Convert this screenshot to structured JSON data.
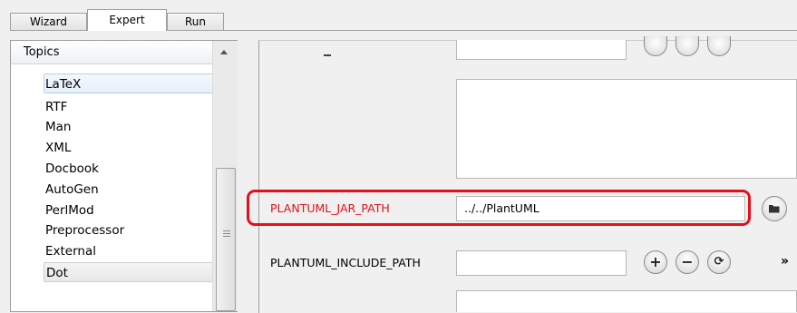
{
  "tabs": [
    {
      "label": "Wizard",
      "active": false
    },
    {
      "label": "Expert",
      "active": true
    },
    {
      "label": "Run",
      "active": false
    }
  ],
  "topics": {
    "header": "Topics",
    "items": [
      "LaTeX",
      "RTF",
      "Man",
      "XML",
      "Docbook",
      "AutoGen",
      "PerlMod",
      "Preprocessor",
      "External",
      "Dot"
    ],
    "selected": "LaTeX"
  },
  "settings": {
    "jar_path": {
      "label": "PLANTUML_JAR_PATH",
      "value": "../../PlantUML",
      "label_color": "#e2111c"
    },
    "include_path": {
      "label": "PLANTUML_INCLUDE_PATH",
      "value": ""
    },
    "buttons": {
      "add": "+",
      "remove": "−",
      "reset": "⟳",
      "more": "»"
    }
  },
  "colors": {
    "highlight": "#e2111c"
  }
}
